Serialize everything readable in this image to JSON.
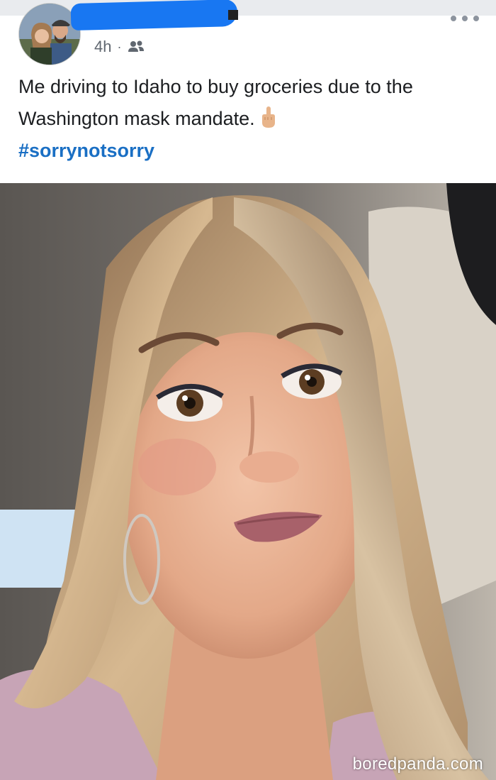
{
  "post": {
    "time": "4h",
    "separator": "·",
    "privacy_icon": "friends-icon",
    "more_icon": "more-options-icon",
    "text": "Me driving to Idaho to buy groceries due to the Washington mask mandate.",
    "emoji": "middle-finger-emoji",
    "hashtag": "#sorrynotsorry"
  },
  "photo": {
    "subject": "selfie-photo"
  },
  "watermark": "boredpanda.com",
  "colors": {
    "hashtag": "#1a6fc4",
    "redaction": "#1877f2",
    "meta_text": "#606770"
  }
}
